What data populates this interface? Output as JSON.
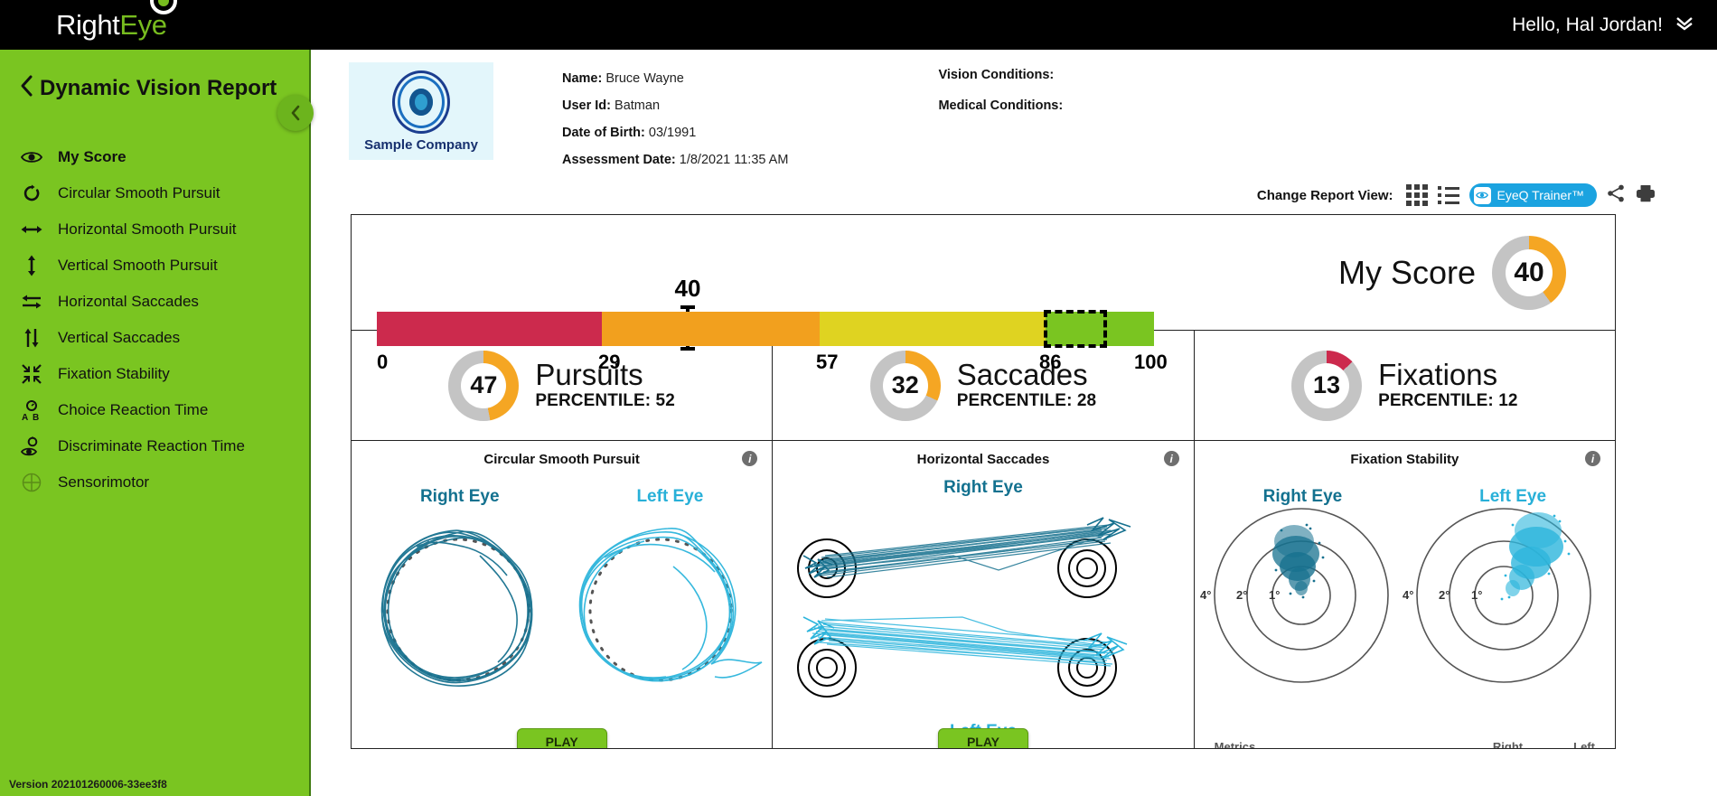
{
  "topbar": {
    "brand_right": "Right",
    "brand_eye": "Eye",
    "greeting": "Hello, Hal Jordan!",
    "chevron": "chevron-double-down"
  },
  "sidebar": {
    "title": "Dynamic Vision Report",
    "back_chevron": "‹",
    "collapse_label": "‹",
    "version": "Version 202101260006-33ee3f8",
    "items": [
      {
        "label": "My Score",
        "icon": "eye-icon",
        "active": true
      },
      {
        "label": "Circular Smooth Pursuit",
        "icon": "circular-arrow-icon",
        "active": false
      },
      {
        "label": "Horizontal Smooth Pursuit",
        "icon": "horizontal-arrow-icon",
        "active": false
      },
      {
        "label": "Vertical Smooth Pursuit",
        "icon": "vertical-arrow-icon",
        "active": false
      },
      {
        "label": "Horizontal Saccades",
        "icon": "horizontal-swap-icon",
        "active": false
      },
      {
        "label": "Vertical Saccades",
        "icon": "vertical-swap-icon",
        "active": false
      },
      {
        "label": "Fixation Stability",
        "icon": "contract-arrows-icon",
        "active": false
      },
      {
        "label": "Choice Reaction Time",
        "icon": "stopwatch-ab-icon",
        "active": false
      },
      {
        "label": "Discriminate Reaction Time",
        "icon": "stopwatch-eye-icon",
        "active": false
      },
      {
        "label": "Sensorimotor",
        "icon": "crosshair-circle-icon",
        "active": false
      }
    ]
  },
  "patient": {
    "company_logo_label": "Sample Company",
    "fields": [
      {
        "label": "Name:",
        "value": "Bruce Wayne"
      },
      {
        "label": "User Id:",
        "value": "Batman"
      },
      {
        "label": "Date of Birth:",
        "value": "03/1991"
      },
      {
        "label": "Assessment Date:",
        "value": "1/8/2021 11:35 AM"
      }
    ],
    "conditions": [
      {
        "label": "Vision Conditions:",
        "value": ""
      },
      {
        "label": "Medical Conditions:",
        "value": ""
      }
    ]
  },
  "viewbar": {
    "label": "Change Report View:",
    "grid_icon": "grid-view-icon",
    "list_icon": "list-view-icon",
    "eyeq_label": "EyeQ Trainer™",
    "share_icon": "share-icon",
    "print_icon": "print-icon"
  },
  "chart_data": [
    {
      "type": "bar",
      "name": "my-score-gauge",
      "title": "My Score",
      "value": 40,
      "marker_label": "40",
      "ticks": [
        0,
        29,
        57,
        86,
        100
      ],
      "tick_labels": [
        "0",
        "29",
        "57",
        "86",
        "100"
      ],
      "xlim": [
        0,
        100
      ],
      "segments": [
        {
          "from": 0,
          "to": 29,
          "color": "#cc2a4d"
        },
        {
          "from": 29,
          "to": 57,
          "color": "#f2a01e"
        },
        {
          "from": 57,
          "to": 86,
          "color": "#dfd321"
        },
        {
          "from": 86,
          "to": 100,
          "color": "#7ac521"
        }
      ],
      "highlight": {
        "from": 86,
        "to": 94
      },
      "donut": {
        "value": 40,
        "max": 100,
        "color": "#f5a623",
        "track": "#c4c4c4"
      }
    },
    {
      "type": "pie",
      "name": "pursuits-donut",
      "title": "Pursuits",
      "subtitle": "PERCENTILE: 52",
      "value": 47,
      "percentile": 52,
      "color": "#f5a623",
      "track": "#c4c4c4"
    },
    {
      "type": "pie",
      "name": "saccades-donut",
      "title": "Saccades",
      "subtitle": "PERCENTILE: 28",
      "value": 32,
      "percentile": 28,
      "color": "#f5a623",
      "track": "#c4c4c4"
    },
    {
      "type": "pie",
      "name": "fixations-donut",
      "title": "Fixations",
      "subtitle": "PERCENTILE: 12",
      "value": 13,
      "percentile": 12,
      "color": "#cc2a4d",
      "track": "#c4c4c4"
    },
    {
      "type": "scatter",
      "name": "circular-smooth-pursuit-plot",
      "title": "Circular Smooth Pursuit",
      "series": [
        {
          "name": "Right Eye",
          "color": "#17718f"
        },
        {
          "name": "Left Eye",
          "color": "#2cb5dc"
        }
      ],
      "target_shape": "dotted-circle"
    },
    {
      "type": "line",
      "name": "horizontal-saccades-plot",
      "title": "Horizontal Saccades",
      "series": [
        {
          "name": "Right Eye",
          "color": "#17718f"
        },
        {
          "name": "Left Eye",
          "color": "#2cb5dc"
        }
      ],
      "targets": "concentric-rings"
    },
    {
      "type": "scatter",
      "name": "fixation-stability-plot",
      "title": "Fixation Stability",
      "series": [
        {
          "name": "Right Eye",
          "color": "#17718f"
        },
        {
          "name": "Left Eye",
          "color": "#2cb5dc"
        }
      ],
      "ring_labels": [
        "4°",
        "2°",
        "1°"
      ]
    }
  ],
  "panels": [
    {
      "title": "Circular Smooth Pursuit",
      "right_eye": "Right Eye",
      "left_eye": "Left Eye",
      "play_label": "PLAY",
      "info": "i"
    },
    {
      "title": "Horizontal Saccades",
      "right_eye": "Right Eye",
      "left_eye": "Left Eye",
      "play_label": "PLAY",
      "info": "i"
    },
    {
      "title": "Fixation Stability",
      "right_eye": "Right Eye",
      "left_eye": "Left Eye",
      "metrics_label": "Metrics",
      "col_right": "Right",
      "col_left": "Left",
      "ring_labels": [
        "4°",
        "2°",
        "1°"
      ],
      "info": "i"
    }
  ],
  "colors": {
    "brand_green": "#7ac521",
    "accent_blue": "#1ba3e0",
    "eye_right": "#17718f",
    "eye_left": "#2cb5dc",
    "orange": "#f5a623",
    "red": "#cc2a4d",
    "yellow": "#dfd321"
  }
}
